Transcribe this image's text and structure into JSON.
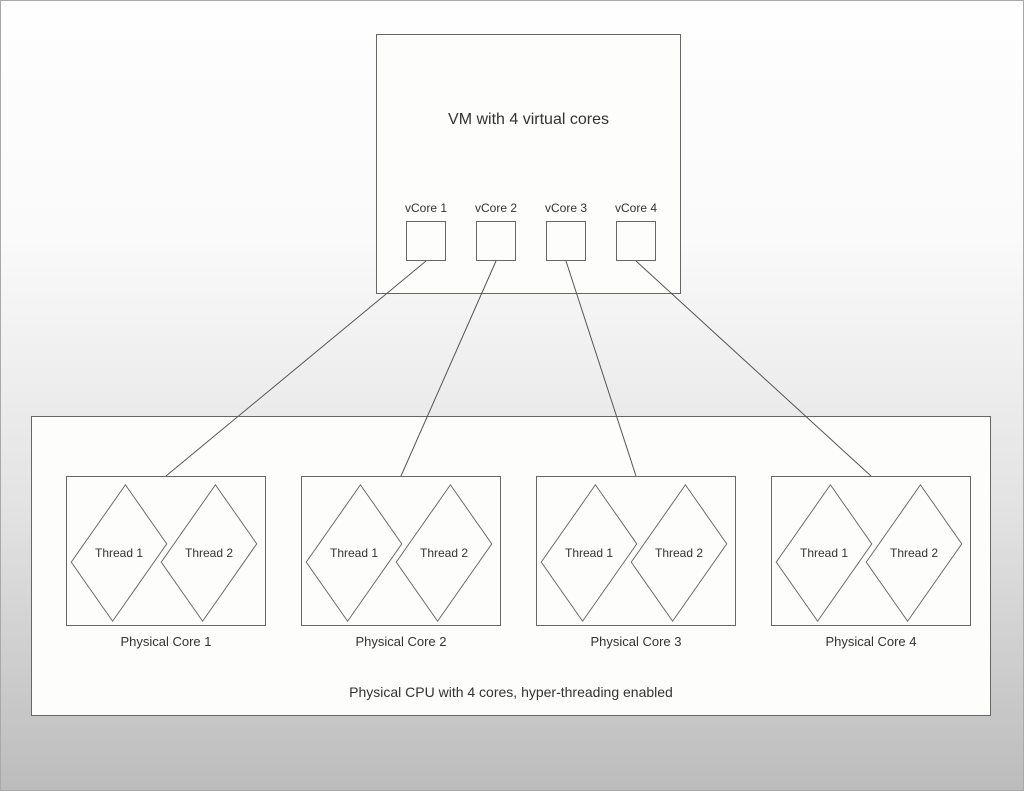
{
  "vm": {
    "title": "VM with 4 virtual cores",
    "cores": [
      {
        "label": "vCore 1"
      },
      {
        "label": "vCore 2"
      },
      {
        "label": "vCore 3"
      },
      {
        "label": "vCore 4"
      }
    ]
  },
  "cpu": {
    "title": "Physical CPU with 4 cores, hyper-threading enabled",
    "cores": [
      {
        "label": "Physical Core 1",
        "threads": [
          "Thread 1",
          "Thread 2"
        ]
      },
      {
        "label": "Physical Core 2",
        "threads": [
          "Thread 1",
          "Thread 2"
        ]
      },
      {
        "label": "Physical Core 3",
        "threads": [
          "Thread 1",
          "Thread 2"
        ]
      },
      {
        "label": "Physical Core 4",
        "threads": [
          "Thread 1",
          "Thread 2"
        ]
      }
    ]
  }
}
